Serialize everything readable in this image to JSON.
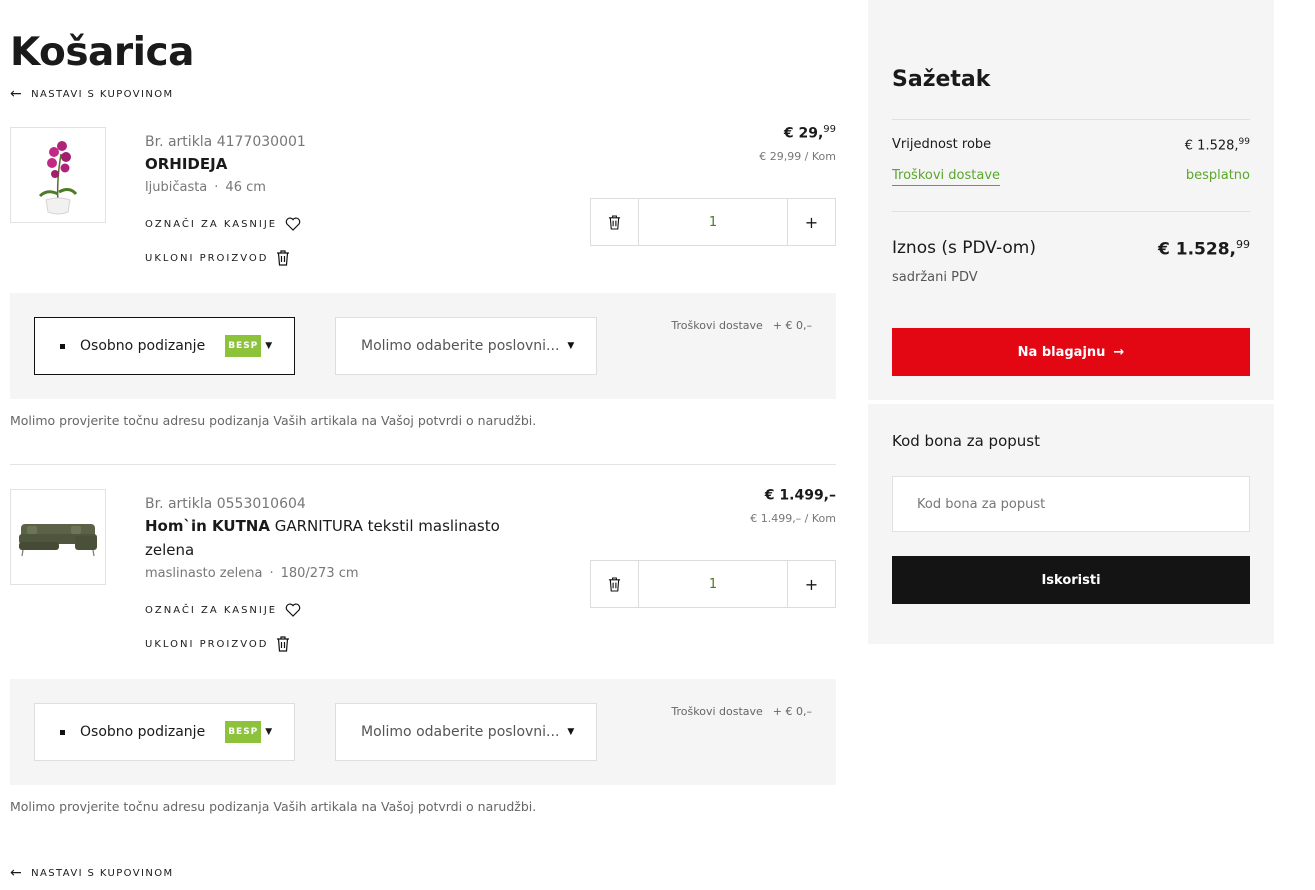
{
  "page": {
    "title": "Košarica",
    "back_link": "NASTAVI S KUPOVINOM"
  },
  "items": [
    {
      "article_no": "Br. artikla 4177030001",
      "name_bold": "ORHIDEJA",
      "name_rest": "",
      "color": "ljubičasta",
      "size": "46 cm",
      "save_label": "OZNAČI ZA KASNIJE",
      "remove_label": "UKLONI PROIZVOD",
      "price_main": "€ 29,",
      "price_cents": "99",
      "unit_price": "€ 29,99 / Kom",
      "quantity": "1",
      "pickup_label": "Osobno podizanje",
      "pickup_badge": "BESP",
      "store_placeholder": "Molimo odaberite poslovni...",
      "shipping_label": "Troškovi dostave",
      "shipping_value": "+ € 0,–",
      "note": "Molimo provjerite točnu adresu podizanja Vaših artikala na Vašoj potvrdi o narudžbi."
    },
    {
      "article_no": "Br. artikla 0553010604",
      "name_bold": "Hom`in KUTNA",
      "name_rest": " GARNITURA tekstil maslinasto zelena",
      "color": "maslinasto zelena",
      "size": "180/273 cm",
      "save_label": "OZNAČI ZA KASNIJE",
      "remove_label": "UKLONI PROIZVOD",
      "price_main": "€ 1.499,–",
      "price_cents": "",
      "unit_price": "€ 1.499,– / Kom",
      "quantity": "1",
      "pickup_label": "Osobno podizanje",
      "pickup_badge": "BESP",
      "store_placeholder": "Molimo odaberite poslovni...",
      "shipping_label": "Troškovi dostave",
      "shipping_value": "+ € 0,–",
      "note": "Molimo provjerite točnu adresu podizanja Vaših artikala na Vašoj potvrdi o narudžbi."
    }
  ],
  "summary": {
    "title": "Sažetak",
    "goods_label": "Vrijednost robe",
    "goods_main": "€ 1.528,",
    "goods_cents": "99",
    "shipping_label": "Troškovi dostave",
    "shipping_value": "besplatno",
    "total_label": "Iznos (s PDV-om)",
    "total_main": "€ 1.528,",
    "total_cents": "99",
    "vat_note": "sadržani PDV",
    "checkout_label": "Na blagajnu",
    "checkout_arrow": "→"
  },
  "voucher": {
    "title": "Kod bona za popust",
    "placeholder": "Kod bona za popust",
    "button_label": "Iskoristi"
  },
  "colors": {
    "accent_red": "#e30613",
    "green": "#5aa72c",
    "badge_green": "#8cc33b",
    "dark": "#141414"
  },
  "icons": [
    "arrow-left-icon",
    "heart-icon",
    "trash-icon",
    "plus-icon",
    "chevron-down-icon",
    "arrow-right-icon",
    "orchid-image",
    "sofa-image"
  ]
}
